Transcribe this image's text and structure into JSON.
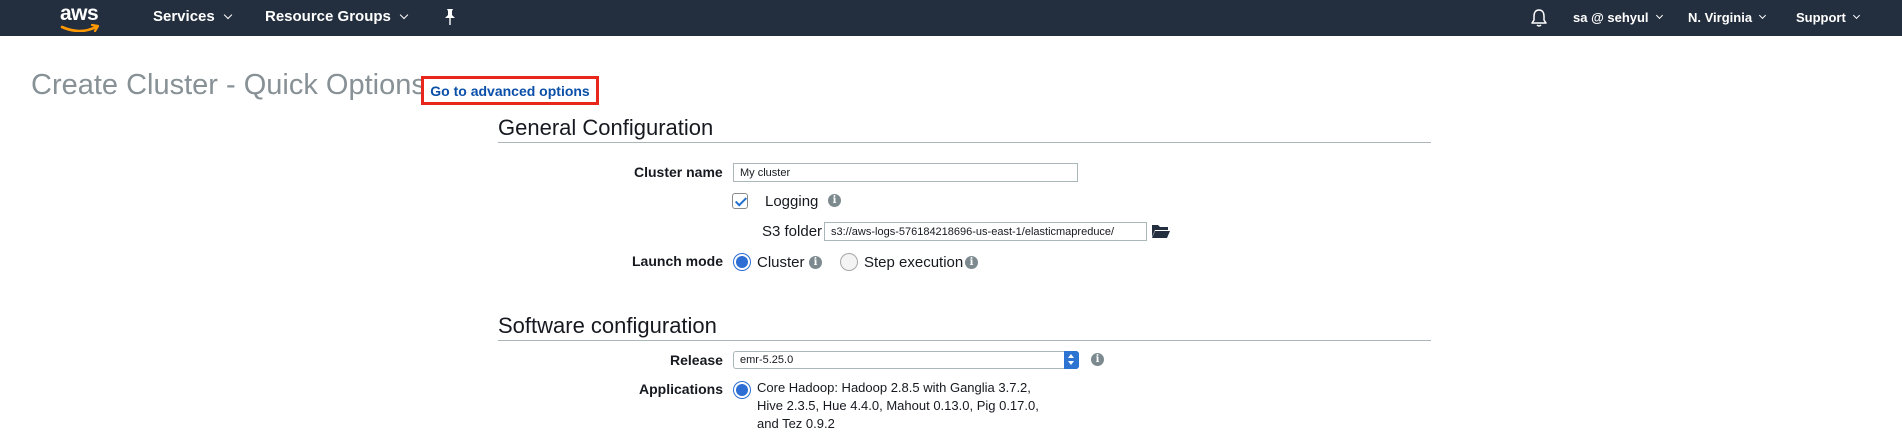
{
  "nav": {
    "logo": "aws",
    "services": "Services",
    "resource_groups": "Resource Groups",
    "account": "sa @ sehyul",
    "region": "N. Virginia",
    "support": "Support"
  },
  "page": {
    "title": "Create Cluster - Quick Options",
    "advanced_link": "Go to advanced options"
  },
  "general": {
    "section_title": "General Configuration",
    "cluster_name_label": "Cluster name",
    "cluster_name_value": "My cluster",
    "logging_label": "Logging",
    "logging_checked": true,
    "s3_folder_label": "S3 folder",
    "s3_folder_value": "s3://aws-logs-576184218696-us-east-1/elasticmapreduce/",
    "launch_mode_label": "Launch mode",
    "launch_options": [
      {
        "label": "Cluster",
        "selected": true
      },
      {
        "label": "Step execution",
        "selected": false
      }
    ]
  },
  "software": {
    "section_title": "Software configuration",
    "release_label": "Release",
    "release_value": "emr-5.25.0",
    "applications_label": "Applications",
    "applications_lines": [
      "Core Hadoop: Hadoop 2.8.5 with Ganglia 3.7.2,",
      "Hive 2.3.5, Hue 4.4.0, Mahout 0.13.0, Pig 0.17.0,",
      "and Tez 0.9.2"
    ]
  },
  "colors": {
    "nav_bg": "#232f3e",
    "highlight_border": "#e8261a",
    "link": "#0a4fa8",
    "accent": "#2c6ed4"
  },
  "icons": [
    "pin-icon",
    "bell-icon",
    "info-icon",
    "folder-icon"
  ]
}
